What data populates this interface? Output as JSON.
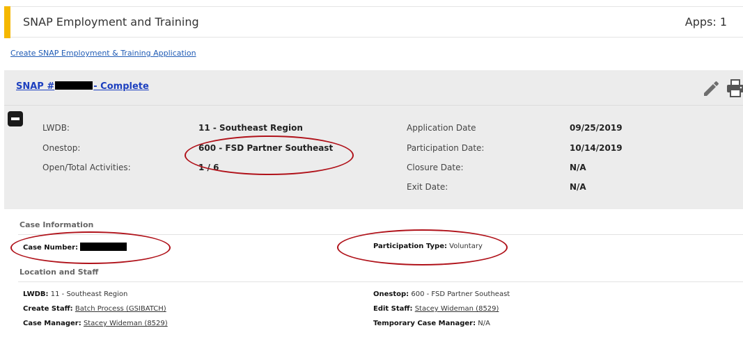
{
  "header": {
    "title": "SNAP Employment and Training",
    "apps_count": "Apps: 1",
    "accent_color": "#f5b800"
  },
  "create_link": "Create SNAP Employment & Training Application",
  "application": {
    "title_prefix": "SNAP #",
    "title_suffix": "- Complete",
    "summary": {
      "lwdb_label": "LWDB:",
      "lwdb_value": "11 - Southeast Region",
      "onestop_label": "Onestop:",
      "onestop_value": "600 - FSD Partner Southeast",
      "activities_label": "Open/Total Activities:",
      "activities_value": "1 / 6",
      "app_date_label": "Application Date",
      "app_date_value": "09/25/2019",
      "part_date_label": "Participation Date:",
      "part_date_value": "10/14/2019",
      "closure_label": "Closure Date:",
      "closure_value": "N/A",
      "exit_label": "Exit Date:",
      "exit_value": "N/A"
    }
  },
  "case_information": {
    "heading": "Case Information",
    "case_number_label": "Case Number:",
    "participation_type_label": "Participation Type:",
    "participation_type_value": "Voluntary"
  },
  "location_staff": {
    "heading": "Location and Staff",
    "lwdb_label": "LWDB:",
    "lwdb_value": "11 - Southeast Region",
    "onestop_label": "Onestop:",
    "onestop_value": "600 - FSD Partner Southeast",
    "create_staff_label": "Create Staff:",
    "create_staff_value": "Batch Process (GSIBATCH)",
    "edit_staff_label": "Edit Staff:",
    "edit_staff_value": "Stacey Wideman (8529)",
    "case_manager_label": "Case Manager:",
    "case_manager_value": "Stacey Wideman (8529)",
    "temp_case_manager_label": "Temporary Case Manager:",
    "temp_case_manager_value": "N/A"
  },
  "icons": {
    "edit": "pencil-icon",
    "print": "printer-icon",
    "collapse": "minus-icon"
  },
  "annotation_color": "#b0121a"
}
